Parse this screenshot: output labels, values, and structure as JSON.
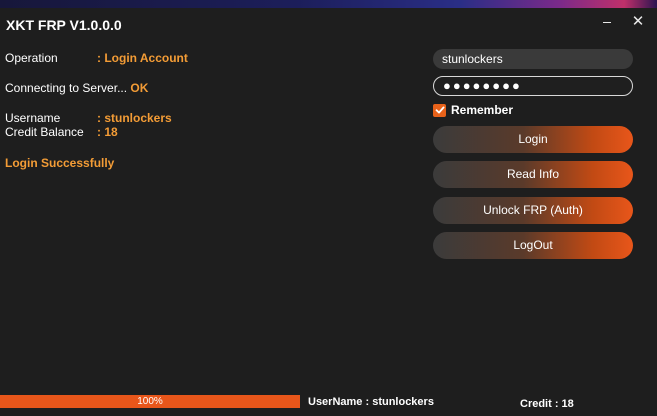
{
  "window": {
    "title": "XKT FRP V1.0.0.0"
  },
  "info": {
    "operation_label": "Operation",
    "operation_value": ": Login Account",
    "connecting_label": "Connecting to  Server...",
    "connecting_value": "OK",
    "username_label": "Username",
    "username_value": ": stunlockers",
    "credit_label": "Credit Balance",
    "credit_value": ": 18",
    "login_message": "Login Successfully"
  },
  "login": {
    "username": "stunlockers",
    "password_masked": "●●●●●●●●",
    "remember_label": "Remember",
    "remember_checked": true
  },
  "actions": {
    "login": "Login",
    "read_info": "Read Info",
    "unlock_frp": "Unlock FRP (Auth)",
    "logout": "LogOut"
  },
  "status": {
    "progress_percent": 100,
    "progress_text": "100%",
    "username": "UserName : stunlockers",
    "credit": "Credit : 18"
  },
  "colors": {
    "accent": "#e8561a",
    "highlight_text": "#f39c36",
    "background": "#1e1e1e"
  },
  "icons": {
    "minimize": "minimize-icon",
    "close": "close-icon",
    "checkbox": "checkmark-icon"
  }
}
